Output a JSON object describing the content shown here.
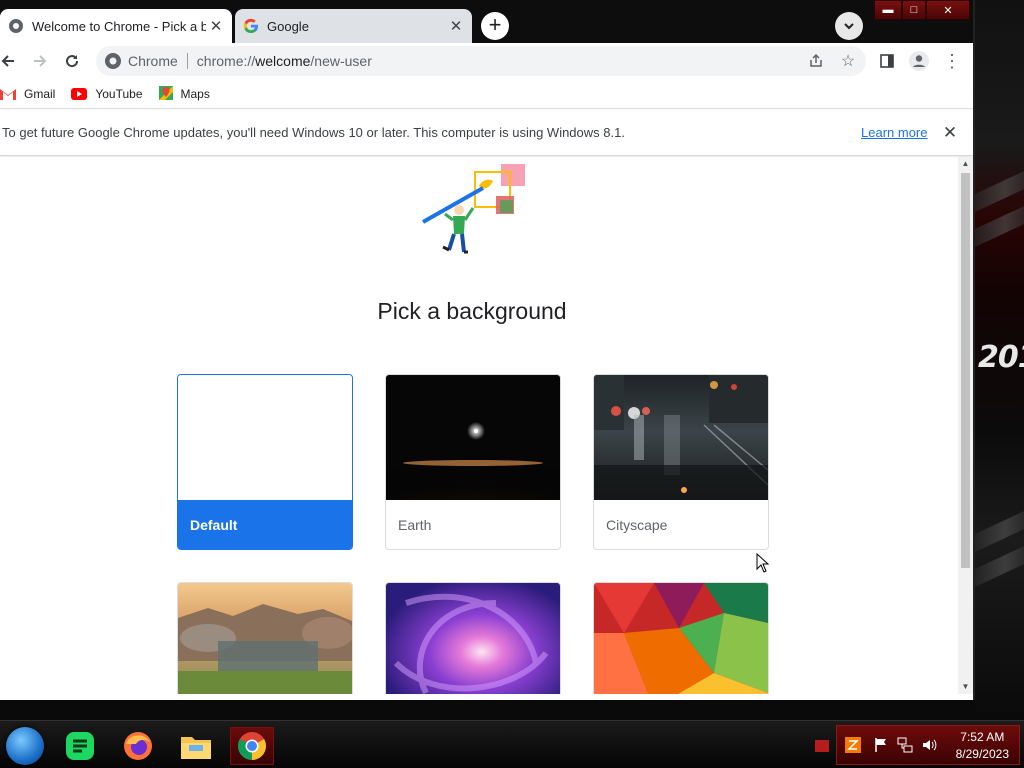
{
  "tabs": [
    {
      "title": "Welcome to Chrome - Pick a background",
      "active": true
    },
    {
      "title": "Google",
      "active": false
    }
  ],
  "toolbar": {
    "site_chip": "Chrome",
    "url_scheme": "chrome://",
    "url_host": "welcome",
    "url_path": "/new-user"
  },
  "bookmarks": [
    {
      "label": "Gmail",
      "icon": "gmail-icon"
    },
    {
      "label": "YouTube",
      "icon": "youtube-icon"
    },
    {
      "label": "Maps",
      "icon": "maps-icon"
    }
  ],
  "infobar": {
    "message": "To get future Google Chrome updates, you'll need Windows 10 or later. This computer is using Windows 8.1.",
    "link": "Learn more"
  },
  "page": {
    "heading": "Pick a background",
    "backgrounds": [
      {
        "label": "Default",
        "selected": true
      },
      {
        "label": "Earth",
        "selected": false
      },
      {
        "label": "Cityscape",
        "selected": false
      },
      {
        "label": "",
        "selected": false
      },
      {
        "label": "",
        "selected": false
      },
      {
        "label": "",
        "selected": false
      }
    ]
  },
  "taskbar": {
    "apps": [
      "start-orb",
      "notes-app",
      "firefox",
      "file-explorer",
      "chrome"
    ],
    "clock_time": "7:52 AM",
    "clock_date": "8/29/2023"
  },
  "desktop": {
    "partial_text": "201"
  },
  "colors": {
    "accent": "#1a73e8",
    "tray": "#6e0a0a"
  }
}
